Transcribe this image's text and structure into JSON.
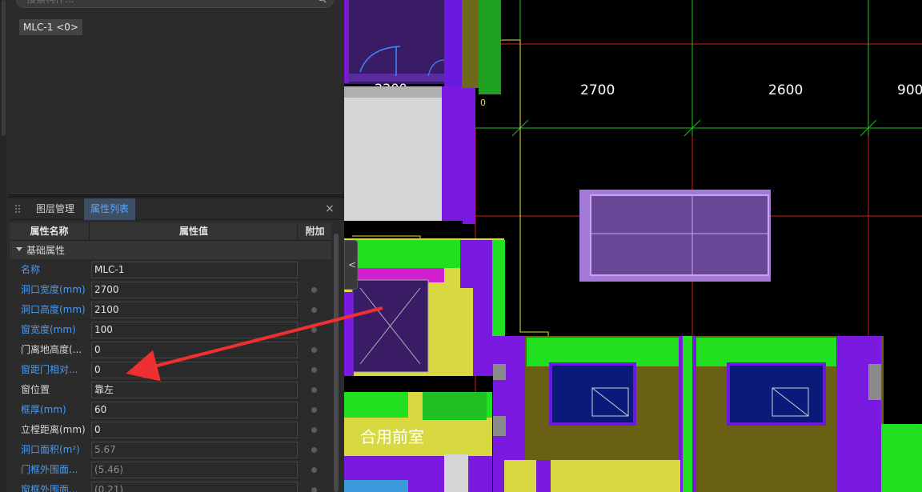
{
  "search": {
    "placeholder": "搜索构件..."
  },
  "component_tag": "MLC-1 <0>",
  "tabs": [
    {
      "label": "图层管理"
    },
    {
      "label": "属性列表"
    }
  ],
  "close_label": "×",
  "table": {
    "headers": {
      "name": "属性名称",
      "value": "属性值",
      "extra": "附加"
    },
    "group": "基础属性",
    "rows": [
      {
        "name": "名称",
        "value": "MLC-1"
      },
      {
        "name": "洞口宽度(mm)",
        "value": "2700"
      },
      {
        "name": "洞口高度(mm)",
        "value": "2100"
      },
      {
        "name": "窗宽度(mm)",
        "value": "100"
      },
      {
        "name": "门离地高度(...",
        "value": "0"
      },
      {
        "name": "窗距门相对...",
        "value": "0"
      },
      {
        "name": "窗位置",
        "value": "靠左"
      },
      {
        "name": "框厚(mm)",
        "value": "60"
      },
      {
        "name": "立樘距离(mm)",
        "value": "0"
      },
      {
        "name": "洞口面积(m²)",
        "value": "5.67"
      },
      {
        "name": "门框外围面...",
        "value": "(5.46)"
      },
      {
        "name": "窗框外围面...",
        "value": "(0.21)"
      }
    ]
  },
  "cad": {
    "dim_2700": "2700",
    "dim_2600": "2600",
    "dim_900": "900",
    "dim_2200": "2200",
    "room_label": "合用前室",
    "small_0": "0"
  },
  "collapse_glyph": "<"
}
